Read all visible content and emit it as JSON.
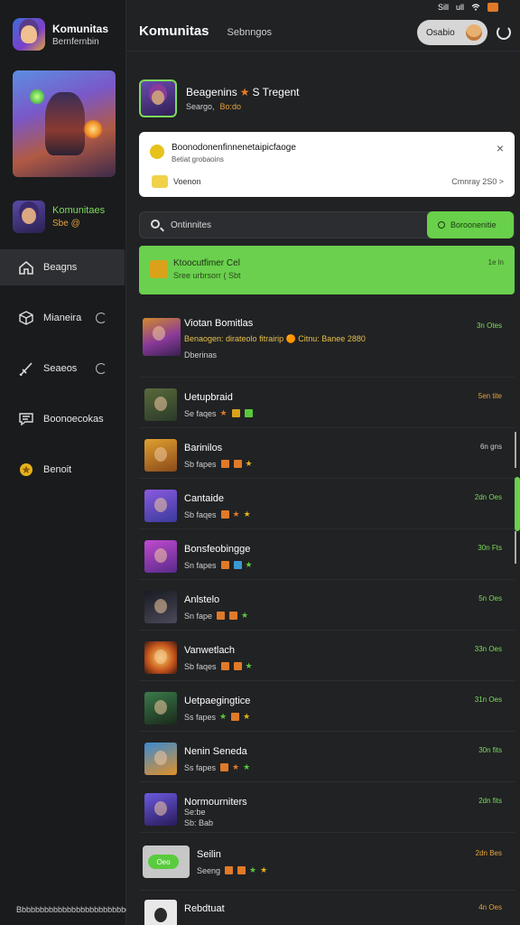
{
  "sidebar": {
    "app_title": "Komunitas",
    "app_subtitle": "Bernfernbin",
    "profile": {
      "name": "Komunitaes",
      "stat": "Sbe @"
    },
    "nav": [
      {
        "label": "Beagns",
        "icon": "home-icon",
        "active": true,
        "badge": false
      },
      {
        "label": "Mianeira",
        "icon": "cube-icon",
        "active": false,
        "badge": true
      },
      {
        "label": "Seaeos",
        "icon": "sword-icon",
        "active": false,
        "badge": true
      },
      {
        "label": "Boonoecokas",
        "icon": "chat-icon",
        "active": false,
        "badge": false
      },
      {
        "label": "Benoit",
        "icon": "star-icon",
        "active": false,
        "badge": false
      }
    ],
    "footer": "Bbbbbbbbbbbbbbbbbbbbbbbbcc"
  },
  "status": {
    "signal": "Sill",
    "wifi": "ull"
  },
  "header": {
    "title": "Komunitas",
    "tab": "Sebnngos",
    "button_label": "Osabio"
  },
  "community": {
    "name": "Beagenins",
    "name_suffix": "S Tregent",
    "meta": "Seargo,",
    "meta_highlight": "Bo:do"
  },
  "notice": {
    "title": "Boonodonenfinnenetaipicfaoge",
    "subtitle": "Betiat grobaoins",
    "close": "×",
    "footer_label": "Voenon",
    "footer_right": "Cmnray 2S0 >"
  },
  "search": {
    "placeholder": "Ontinnites",
    "button_label": "Boroonenitie"
  },
  "highlight": {
    "title": "Ktoocutfimer Cel",
    "subtitle": "Sree urbrsorr ( Sbt",
    "right": "1e ln"
  },
  "featured": {
    "name": "Viotan Bomitlas",
    "desc": "Benaogen: dirateolo fitrairip 🟠 Citnu: Banee 2880",
    "desc2": "Dberinas",
    "time": "3n Otes"
  },
  "rows": [
    {
      "name": "Uetupbraid",
      "meta": "Se faqes",
      "time": "5en tite"
    },
    {
      "name": "Barinilos",
      "meta": "Sb fapes",
      "time": "6n gns"
    },
    {
      "name": "Cantaide",
      "meta": "Sb faqes",
      "time": "2dn Oes"
    },
    {
      "name": "Bonsfeobingge",
      "meta": "Sn fapes",
      "time": "30n Fts"
    },
    {
      "name": "Anlstelo",
      "meta": "Sn fape",
      "time": "5n Oes"
    },
    {
      "name": "Vanwetlach",
      "meta": "Sb faqes",
      "time": "33n Oes"
    },
    {
      "name": "Uetpaegingtice",
      "meta": "Ss fapes",
      "time": "31n Oes"
    },
    {
      "name": "Nenin Seneda",
      "meta": "Ss fapes",
      "time": "30n fits"
    },
    {
      "name": "Normourniters",
      "meta": "Se:be",
      "meta2": "Sb: Bab",
      "time": "2dn fits"
    }
  ],
  "last_row": {
    "name": "Seilin",
    "pill": "Oeo",
    "meta": "Seeng",
    "time": "2dn Bes"
  },
  "partial_row": {
    "name": "Rebdtuat",
    "time": "4n Oes"
  },
  "colors": {
    "accent_green": "#6ad04e",
    "orange": "#e6a43a",
    "bg": "#1e1f21"
  }
}
